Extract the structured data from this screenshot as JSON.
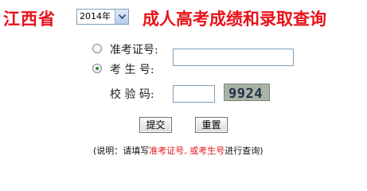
{
  "header": {
    "province": "江西省",
    "year_selected": "2014年",
    "title": "成人高考成绩和录取查询"
  },
  "form": {
    "option_exam_id": "准考证号:",
    "option_candidate_id": "考 生 号:",
    "captcha_label": "校 验 码:",
    "candidate_id_value": "",
    "captcha_input_value": "",
    "captcha_text": "9924"
  },
  "buttons": {
    "submit": "提交",
    "reset": "重置"
  },
  "note": {
    "prefix": "(说明：请填写",
    "highlight1": "准考证号",
    "separator": ", ",
    "highlight2": "或考生号",
    "suffix": "进行查询)"
  },
  "colors": {
    "title_red": "#e8121a"
  }
}
